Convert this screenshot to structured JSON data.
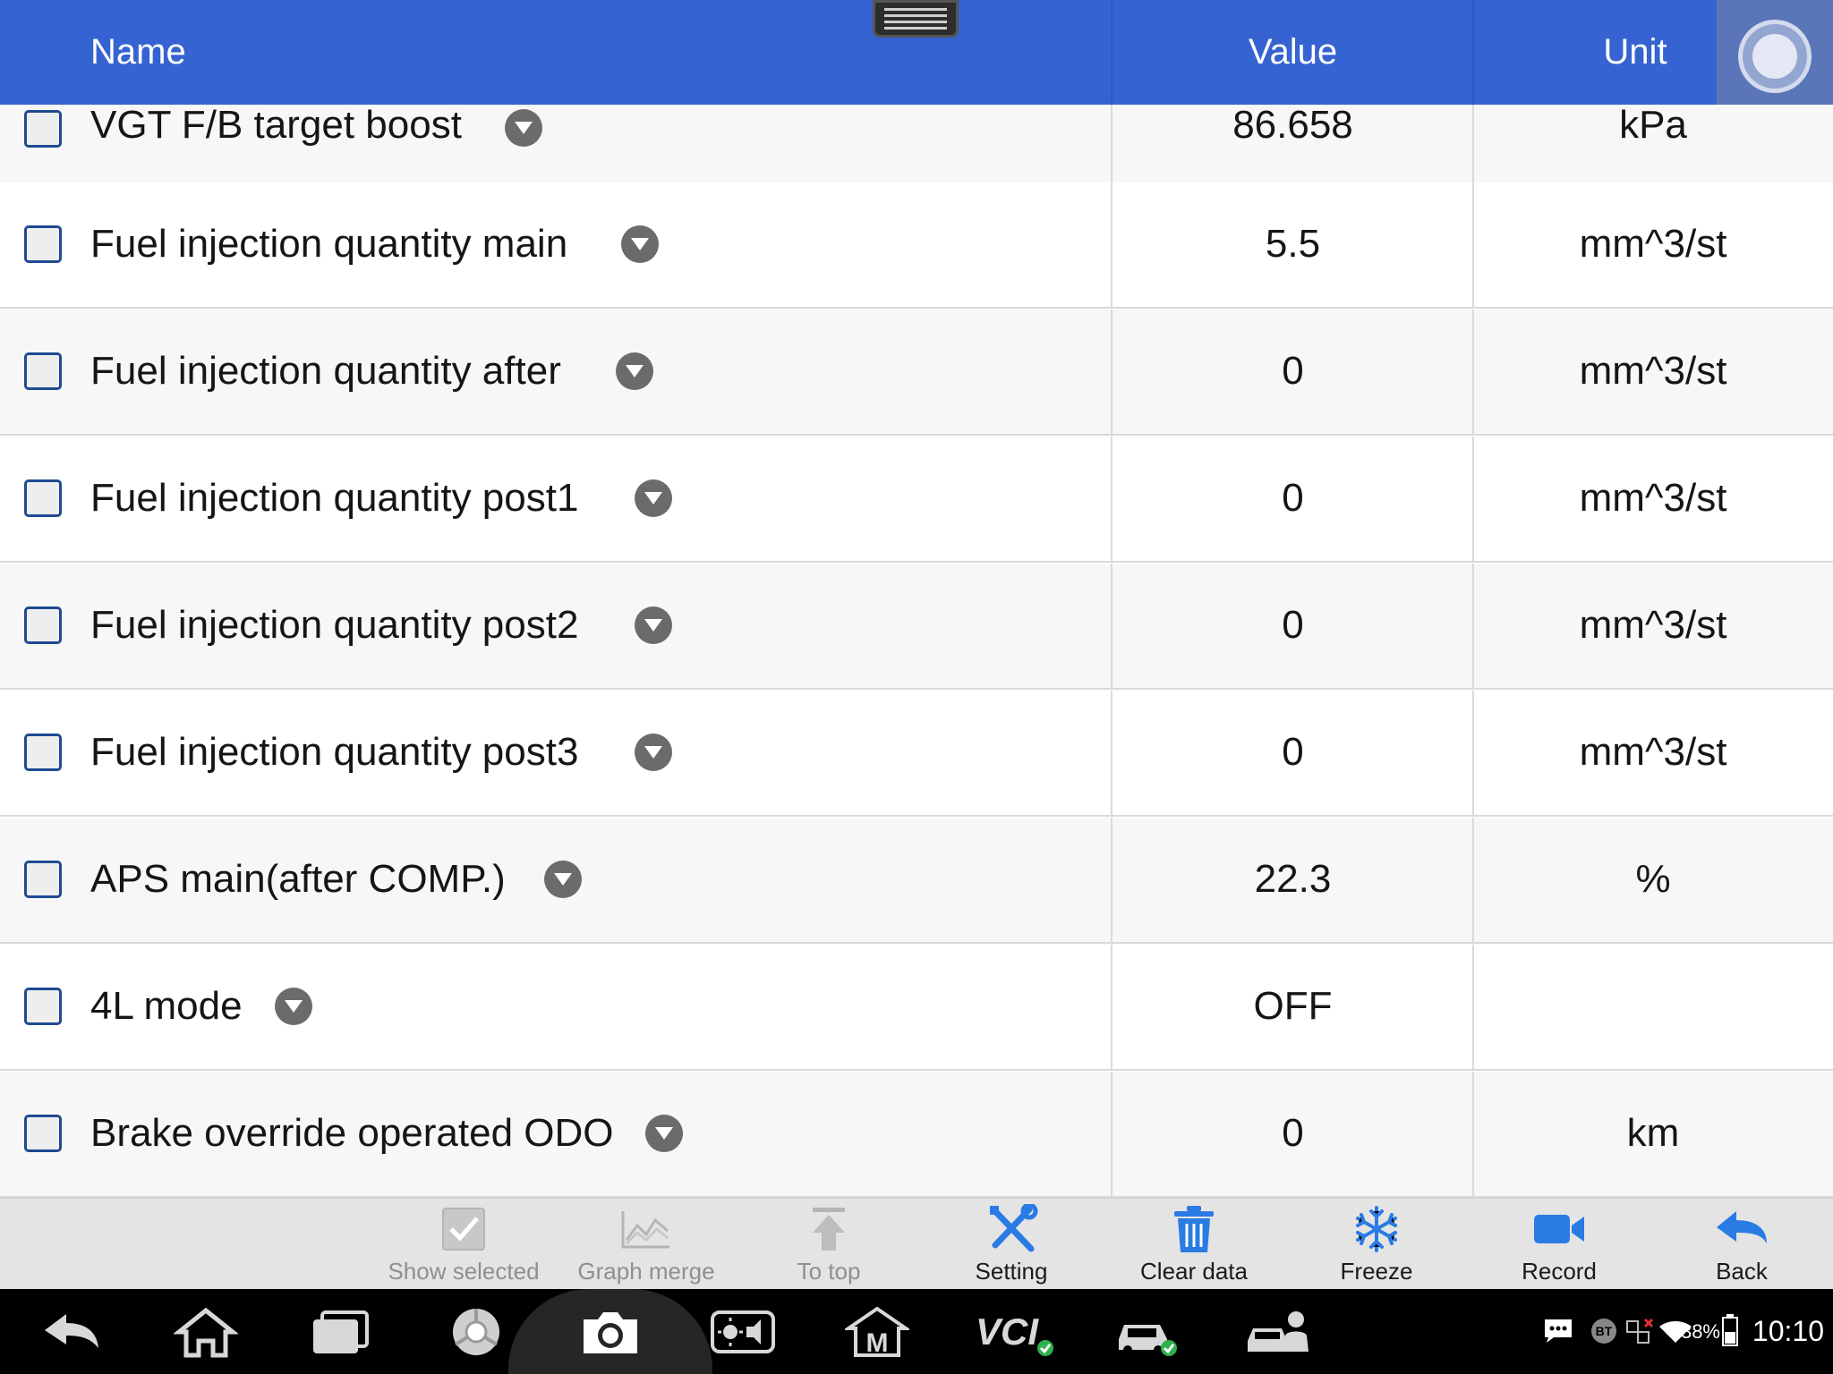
{
  "header": {
    "name_label": "Name",
    "value_label": "Value",
    "unit_label": "Unit"
  },
  "rows": [
    {
      "name": "VGT F/B target boost",
      "value": "86.658",
      "unit": "kPa"
    },
    {
      "name": "Fuel injection quantity main",
      "value": "5.5",
      "unit": "mm^3/st"
    },
    {
      "name": "Fuel injection quantity after",
      "value": "0",
      "unit": "mm^3/st"
    },
    {
      "name": "Fuel injection quantity post1",
      "value": "0",
      "unit": "mm^3/st"
    },
    {
      "name": "Fuel injection quantity post2",
      "value": "0",
      "unit": "mm^3/st"
    },
    {
      "name": "Fuel injection quantity post3",
      "value": "0",
      "unit": "mm^3/st"
    },
    {
      "name": "APS main(after COMP.)",
      "value": "22.3",
      "unit": "%"
    },
    {
      "name": "4L mode",
      "value": "OFF",
      "unit": ""
    },
    {
      "name": "Brake override operated ODO",
      "value": "0",
      "unit": "km"
    }
  ],
  "toolbar": {
    "show_selected": "Show selected",
    "graph_merge": "Graph merge",
    "to_top": "To top",
    "setting": "Setting",
    "clear_data": "Clear data",
    "freeze": "Freeze",
    "record": "Record",
    "back": "Back"
  },
  "status_bar": {
    "bt": "BT",
    "battery": "38%",
    "time": "10:10"
  },
  "icons": {
    "nav": [
      "back-arrow-icon",
      "home-icon",
      "recent-apps-icon",
      "chrome-icon",
      "camera-icon",
      "display-volume-icon",
      "maxifix-m-icon",
      "vci-icon",
      "car-check-icon",
      "car-service-icon"
    ]
  },
  "colors": {
    "accent": "#3563d1",
    "toolbar_icon_blue": "#2a7be4",
    "status_ok": "#2db24b"
  }
}
